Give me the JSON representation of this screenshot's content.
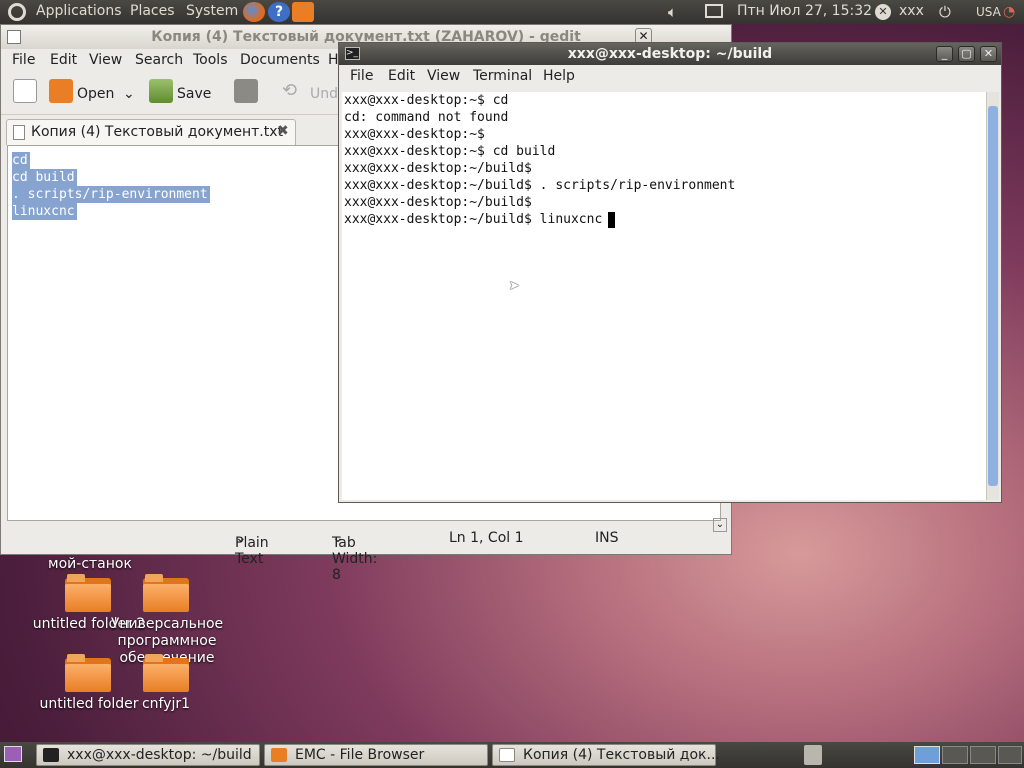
{
  "top_panel": {
    "menus": [
      "Applications",
      "Places",
      "System"
    ],
    "clock": "Птн Июл 27, 15:32",
    "user": "xxx",
    "keyboard_layout": "USA"
  },
  "gedit": {
    "title": "Копия (4) Текстовый документ.txt (ZAHAROV) - gedit",
    "menu": [
      "File",
      "Edit",
      "View",
      "Search",
      "Tools",
      "Documents",
      "H"
    ],
    "toolbar": {
      "open": "Open",
      "save": "Save",
      "undo": "Undo"
    },
    "tab_title": "Копия (4) Текстовый документ.txt",
    "lines": [
      "cd",
      "cd build",
      ". scripts/rip-environment",
      "linuxcnc"
    ],
    "status": {
      "language": "Plain Text",
      "tab_width": "Tab Width:  8",
      "position": "Ln 1, Col 1",
      "mode": "INS"
    }
  },
  "terminal": {
    "title": "xxx@xxx-desktop: ~/build",
    "menu": [
      "File",
      "Edit",
      "View",
      "Terminal",
      "Help"
    ],
    "lines": [
      "xxx@xxx-desktop:~$ cd",
      "cd: command not found",
      "xxx@xxx-desktop:~$",
      "xxx@xxx-desktop:~$ cd build",
      "xxx@xxx-desktop:~/build$",
      "xxx@xxx-desktop:~/build$ . scripts/rip-environment",
      "xxx@xxx-desktop:~/build$",
      "xxx@xxx-desktop:~/build$ linuxcnc"
    ]
  },
  "desktop": {
    "icons": [
      {
        "label": "мой-станок"
      },
      {
        "label": "untitled folder 2"
      },
      {
        "label": "Универсальное программное обеспечение СКИФ"
      },
      {
        "label": "untitled folder"
      },
      {
        "label": "cnfyjr1"
      }
    ]
  },
  "taskbar": {
    "items": [
      "xxx@xxx-desktop: ~/build",
      "EMC - File Browser",
      "Копия (4) Текстовый док..."
    ]
  },
  "colors": {
    "selection": "#86a4cf",
    "folder": "#e97e24",
    "panel": "#3c3b37"
  }
}
